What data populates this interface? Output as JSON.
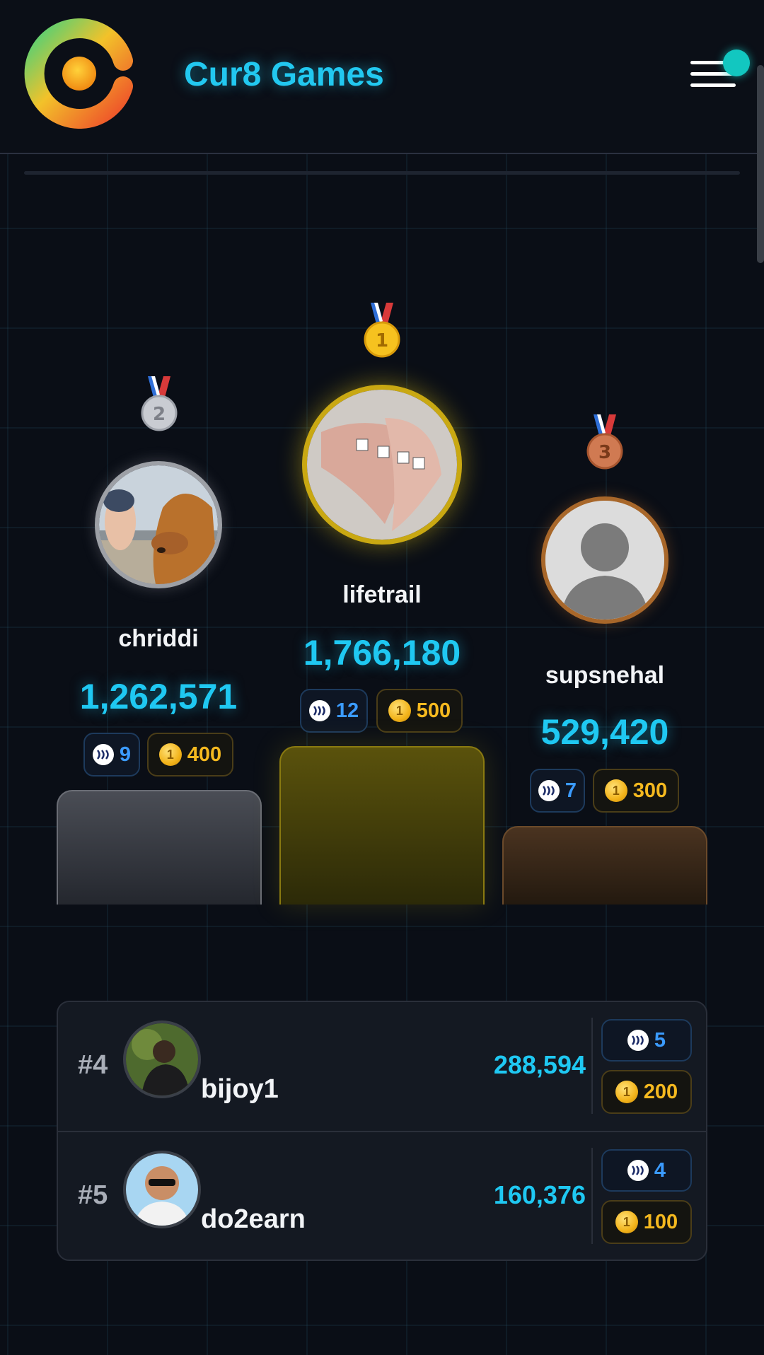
{
  "header": {
    "app_title": "Cur8 Games",
    "logo_icon": "cur8-logo-icon",
    "menu_icon": "hamburger-menu-icon"
  },
  "colors": {
    "accent_cyan": "#1fc8f2",
    "gold": "#f5b91f",
    "steem_blue": "#3b9bff",
    "background": "#0a0e16"
  },
  "podium": {
    "first": {
      "rank_medal": "1",
      "username": "lifetrail",
      "score": "1,766,180",
      "steem": "12",
      "coins": "500"
    },
    "second": {
      "rank_medal": "2",
      "username": "chriddi",
      "score": "1,262,571",
      "steem": "9",
      "coins": "400"
    },
    "third": {
      "rank_medal": "3",
      "username": "supsnehal",
      "score": "529,420",
      "steem": "7",
      "coins": "300"
    }
  },
  "leaderboard": [
    {
      "rank": "#4",
      "username": "bijoy1",
      "score": "288,594",
      "steem": "5",
      "coins": "200"
    },
    {
      "rank": "#5",
      "username": "do2earn",
      "score": "160,376",
      "steem": "4",
      "coins": "100"
    }
  ]
}
